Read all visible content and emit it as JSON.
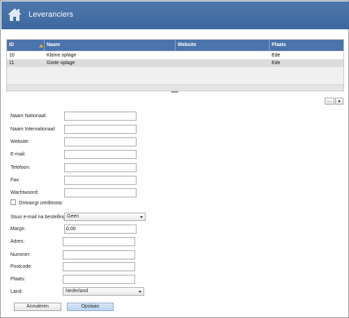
{
  "header": {
    "title": "Leveranciers",
    "icon": "home-icon"
  },
  "grid": {
    "columns": [
      "ID",
      "Naam",
      "Website",
      "Plaats"
    ],
    "sort_column": "ID",
    "sort_direction": "ascending",
    "rows": [
      {
        "id": "10",
        "naam": "Kleine oplage",
        "website": "",
        "plaats": "Ede"
      },
      {
        "id": "11",
        "naam": "Grote oplage",
        "website": "",
        "plaats": "Ede"
      }
    ]
  },
  "toolbar": {
    "more_label": "...",
    "dropdown_icon": "caret-down-icon"
  },
  "form": {
    "naam_nationaal": {
      "label": "Naam Nationaal:",
      "value": ""
    },
    "naam_internationaal": {
      "label": "Naam Internationaal:",
      "value": ""
    },
    "website": {
      "label": "Website:",
      "value": ""
    },
    "email": {
      "label": "E-mail:",
      "value": ""
    },
    "telefoon": {
      "label": "Telefoon:",
      "value": ""
    },
    "fax": {
      "label": "Fax:",
      "value": ""
    },
    "wachtwoord": {
      "label": "Wachtwoord:",
      "value": ""
    },
    "creditnota": {
      "label": "Ontvangt creditnota:",
      "checked": false
    },
    "stuur_email": {
      "label": "Stuur e-mail na bestelling:",
      "value": "Geen"
    },
    "marge": {
      "label": "Marge:",
      "value": "0,00"
    },
    "adres": {
      "label": "Adres:",
      "value": ""
    },
    "nummer": {
      "label": "Nummer:",
      "value": ""
    },
    "postcode": {
      "label": "Postcode:",
      "value": ""
    },
    "plaats": {
      "label": "Plaats:",
      "value": ""
    },
    "land": {
      "label": "Land:",
      "value": "Nederland"
    }
  },
  "buttons": {
    "cancel": "Annuleren",
    "save": "Opslaan"
  },
  "colors": {
    "header": "#3f6ba3",
    "grid_header": "#4a74ab",
    "sort_icon": "#f0a830",
    "save_button": "#c6dcf5"
  }
}
